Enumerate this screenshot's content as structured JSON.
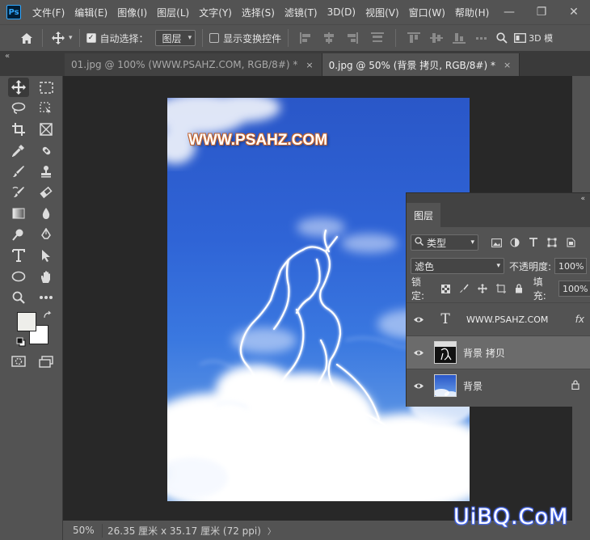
{
  "app": {
    "logo": "Ps"
  },
  "menu": [
    "文件(F)",
    "编辑(E)",
    "图像(I)",
    "图层(L)",
    "文字(Y)",
    "选择(S)",
    "滤镜(T)",
    "3D(D)",
    "视图(V)",
    "窗口(W)",
    "帮助(H)"
  ],
  "window_controls": {
    "minimize": "—",
    "restore": "❐",
    "close": "✕"
  },
  "options": {
    "auto_select_label": "自动选择：",
    "auto_select_target": "图层",
    "show_transform_label": "显示变换控件",
    "mode_3d_label": "3D 模"
  },
  "tabs": [
    {
      "label": "01.jpg @ 100% (WWW.PSAHZ.COM, RGB/8#) *",
      "close": "×"
    },
    {
      "label": "0.jpg @ 50% (背景 拷贝, RGB/8#) *",
      "close": "×"
    }
  ],
  "collapse_arrows": "«",
  "canvas": {
    "watermark": "WWW.PSAHZ.COM"
  },
  "status": {
    "zoom": "50%",
    "doc_info": "26.35 厘米 x 35.17 厘米 (72 ppi)",
    "arrow": "〉"
  },
  "layers_panel": {
    "collapse": "«",
    "tab": "图层",
    "filter_kind": "类型",
    "blend_mode": "滤色",
    "opacity_label": "不透明度:",
    "opacity_value": "100%",
    "lock_label": "锁定:",
    "fill_label": "填充:",
    "fill_value": "100%",
    "layers": [
      {
        "name": "WWW.PSAHZ.COM",
        "type": "text",
        "thumb": "T",
        "right": "fx"
      },
      {
        "name": "背景 拷贝",
        "type": "image",
        "selected": true
      },
      {
        "name": "背景",
        "type": "image",
        "locked": true,
        "right": "🔒"
      }
    ]
  },
  "site_watermark": "UiBQ.CoM",
  "colors": {
    "accent": "#31a8ff",
    "sky": "#2f64d6"
  }
}
